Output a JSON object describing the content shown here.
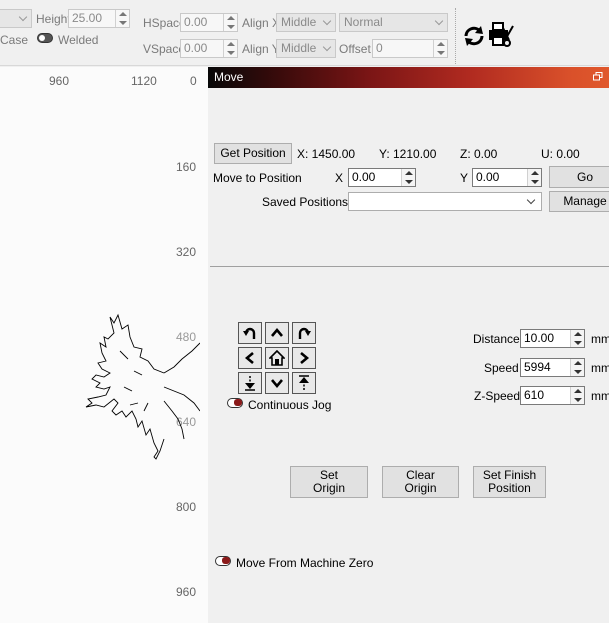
{
  "toolbar": {
    "height_label": "Height",
    "height_value": "25.00",
    "case_label": "Case",
    "welded_label": "Welded",
    "hspace_label": "HSpace",
    "hspace_value": "0.00",
    "vspace_label": "VSpace",
    "vspace_value": "0.00",
    "align_x_label": "Align X",
    "align_x_value": "Middle",
    "align_y_label": "Align Y",
    "align_y_value": "Middle",
    "style_value": "Normal",
    "offset_label": "Offset",
    "offset_value": "0",
    "icons": [
      "rotate-cycle-icon",
      "printer-scissors-icon"
    ]
  },
  "canvas": {
    "top_ruler": [
      "960",
      "1120",
      "0"
    ],
    "side_ruler": [
      "160",
      "320",
      "480",
      "640",
      "800",
      "960"
    ],
    "artwork": "maple-leaf-outline"
  },
  "move_panel": {
    "title": "Move",
    "get_position_label": "Get Position",
    "pos_x": "X: 1450.00",
    "pos_y": "Y: 1210.00",
    "pos_z": "Z: 0.00",
    "pos_u": "U: 0.00",
    "move_to_label": "Move to Position",
    "x_label": "X",
    "x_value": "0.00",
    "y_label": "Y",
    "y_value": "0.00",
    "go_label": "Go",
    "saved_label": "Saved Positions:",
    "saved_value": "",
    "manage_label": "Manage",
    "distance_label": "Distance",
    "distance_value": "10.00",
    "distance_unit": "mm",
    "speed_label": "Speed",
    "speed_value": "5994",
    "speed_unit": "mm/",
    "zspeed_label": "Z-Speed",
    "zspeed_value": "610",
    "zspeed_unit": "mm/",
    "continuous_jog_label": "Continuous Jog",
    "set_origin_label": "Set\nOrigin",
    "clear_origin_label": "Clear\nOrigin",
    "set_finish_label": "Set Finish\nPosition",
    "move_from_zero_label": "Move From Machine Zero",
    "toggle_color": "#8b1a1a"
  }
}
